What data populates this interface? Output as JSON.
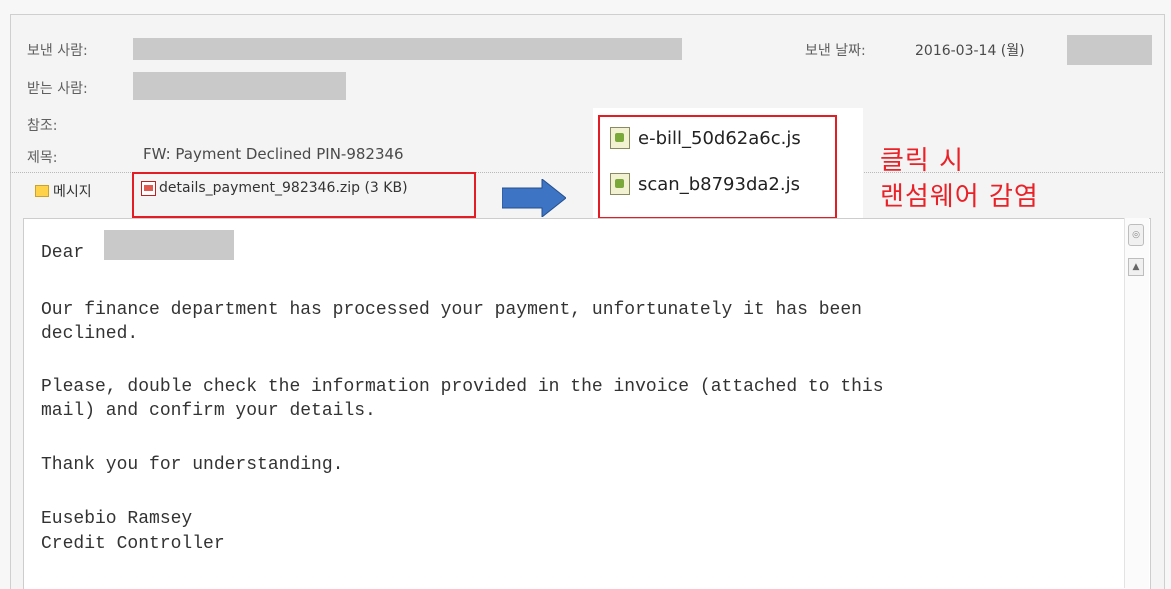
{
  "header": {
    "from_label": "보낸 사람:",
    "date_label": "보낸 날짜:",
    "date_value": "2016-03-14 (월)",
    "to_label": "받는 사람:",
    "cc_label": "참조:",
    "subject_label": "제목:",
    "subject_value": "FW: Payment Declined PIN-982346"
  },
  "tabs": {
    "message_label": "메시지",
    "attachment_label": "details_payment_982346.zip (3 KB)"
  },
  "popup": {
    "files": [
      "e-bill_50d62a6c.js",
      "scan_b8793da2.js"
    ]
  },
  "annotation": {
    "line1": "클릭 시",
    "line2": "랜섬웨어 감염",
    "color": "#ea2127"
  },
  "body": {
    "greeting": "Dear",
    "p1_line1": "Our finance department has processed your payment, unfortunately it has been",
    "p1_line2": "declined.",
    "p2_line1": "Please, double check the information provided in the invoice (attached to this",
    "p2_line2": "mail) and confirm your details.",
    "p3": "Thank you for understanding.",
    "sig_name": "Eusebio Ramsey",
    "sig_title": "Credit Controller"
  }
}
